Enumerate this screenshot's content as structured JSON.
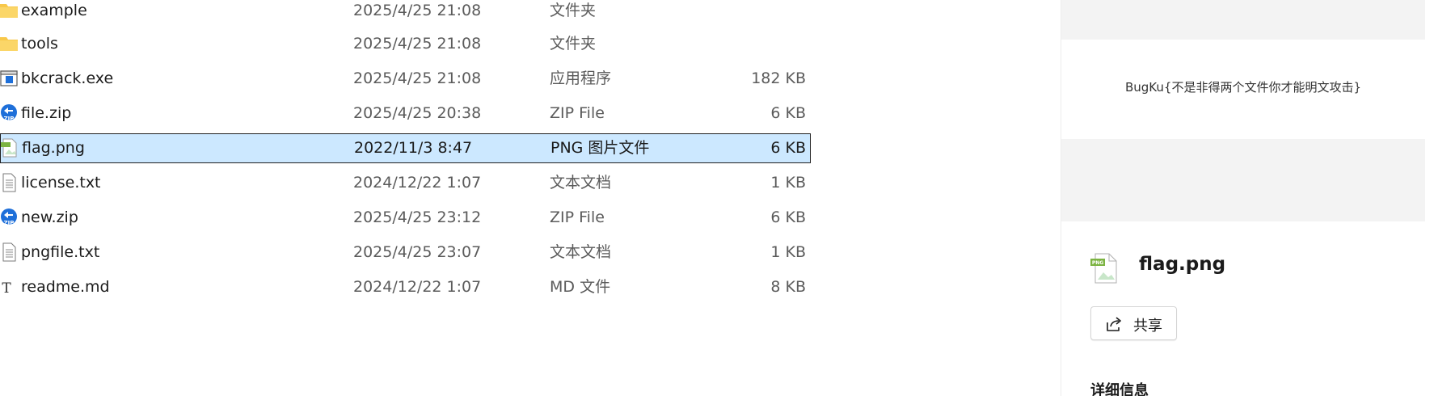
{
  "files": [
    {
      "name": "example",
      "date": "2025/4/25 21:08",
      "type": "文件夹",
      "size": "",
      "icon": "folder-icon"
    },
    {
      "name": "tools",
      "date": "2025/4/25 21:08",
      "type": "文件夹",
      "size": "",
      "icon": "folder-icon"
    },
    {
      "name": "bkcrack.exe",
      "date": "2025/4/25 21:08",
      "type": "应用程序",
      "size": "182 KB",
      "icon": "exe-icon"
    },
    {
      "name": "file.zip",
      "date": "2025/4/25 20:38",
      "type": "ZIP File",
      "size": "6 KB",
      "icon": "zip-icon"
    },
    {
      "name": "flag.png",
      "date": "2022/11/3 8:47",
      "type": "PNG 图片文件",
      "size": "6 KB",
      "icon": "png-icon",
      "selected": true
    },
    {
      "name": "license.txt",
      "date": "2024/12/22 1:07",
      "type": "文本文档",
      "size": "1 KB",
      "icon": "text-file-icon"
    },
    {
      "name": "new.zip",
      "date": "2025/4/25 23:12",
      "type": "ZIP File",
      "size": "6 KB",
      "icon": "zip-icon"
    },
    {
      "name": "pngfile.txt",
      "date": "2025/4/25 23:07",
      "type": "文本文档",
      "size": "1 KB",
      "icon": "text-file-icon"
    },
    {
      "name": "readme.md",
      "date": "2024/12/22 1:07",
      "type": "MD 文件",
      "size": "8 KB",
      "icon": "markdown-file-icon"
    }
  ],
  "preview": {
    "image_text": "BugKu{不是非得两个文件你才能明文攻击}",
    "file_name": "flag.png",
    "file_icon": "png-icon",
    "share_label": "共享",
    "share_icon": "share-icon",
    "details_heading": "详细信息"
  },
  "colors": {
    "selected_row": "#cce8ff",
    "folder": "#f8c84a",
    "zip_badge": "#1e6fd9",
    "pane_band": "#f3f3f3"
  }
}
